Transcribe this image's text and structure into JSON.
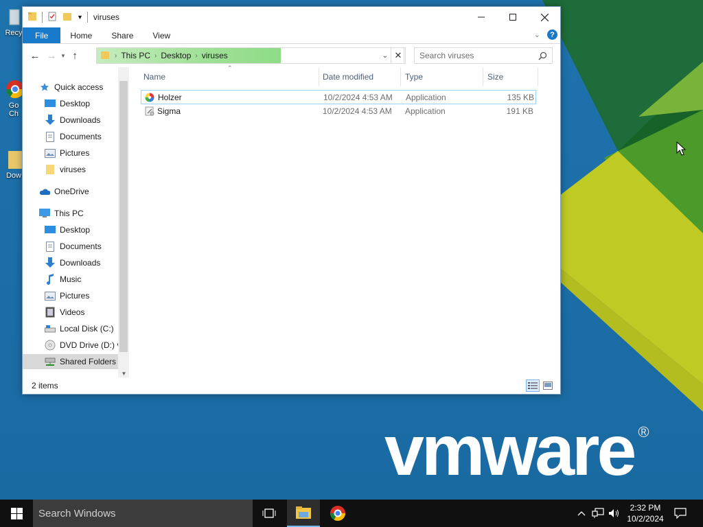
{
  "desktop": {
    "icons": [
      {
        "label": "Recy"
      },
      {
        "label": "Go\nCh"
      },
      {
        "label": "Dow"
      }
    ],
    "brand": "vmware",
    "brand_mark": "®"
  },
  "window": {
    "title": "viruses",
    "ribbon": {
      "tabs": [
        "File",
        "Home",
        "Share",
        "View"
      ]
    },
    "address": {
      "crumbs": [
        "This PC",
        "Desktop",
        "viruses"
      ]
    },
    "search": {
      "placeholder": "Search viruses"
    },
    "nav": {
      "quick_access": "Quick access",
      "quick_items": [
        {
          "label": "Desktop",
          "icon": "desktop-icon"
        },
        {
          "label": "Downloads",
          "icon": "downloads-icon"
        },
        {
          "label": "Documents",
          "icon": "documents-icon"
        },
        {
          "label": "Pictures",
          "icon": "pictures-icon"
        },
        {
          "label": "viruses",
          "icon": "folder-icon"
        }
      ],
      "onedrive": "OneDrive",
      "this_pc": "This PC",
      "pc_items": [
        {
          "label": "Desktop",
          "icon": "desktop-icon"
        },
        {
          "label": "Documents",
          "icon": "documents-icon"
        },
        {
          "label": "Downloads",
          "icon": "downloads-icon"
        },
        {
          "label": "Music",
          "icon": "music-icon"
        },
        {
          "label": "Pictures",
          "icon": "pictures-icon"
        },
        {
          "label": "Videos",
          "icon": "videos-icon"
        },
        {
          "label": "Local Disk (C:)",
          "icon": "disk-icon"
        },
        {
          "label": "DVD Drive (D:) vi",
          "icon": "dvd-icon"
        },
        {
          "label": "Shared Folders (\\",
          "icon": "network-drive-icon"
        }
      ]
    },
    "columns": {
      "name": "Name",
      "date": "Date modified",
      "type": "Type",
      "size": "Size"
    },
    "files": [
      {
        "name": "Holzer",
        "date": "10/2/2024 4:53 AM",
        "type": "Application",
        "size": "135 KB"
      },
      {
        "name": "Sigma",
        "date": "10/2/2024 4:53 AM",
        "type": "Application",
        "size": "191 KB"
      }
    ],
    "status": "2 items"
  },
  "taskbar": {
    "search_placeholder": "Search Windows",
    "time": "2:32 PM",
    "date": "10/2/2024"
  },
  "colors": {
    "desktop_blue": "#1e72ad",
    "ribbon_file": "#1979ca",
    "address_progress": "#9fe096",
    "vm_green_dark": "#2f8b2f",
    "vm_green": "#55a83a",
    "vm_yellow": "#c9cf2a"
  }
}
